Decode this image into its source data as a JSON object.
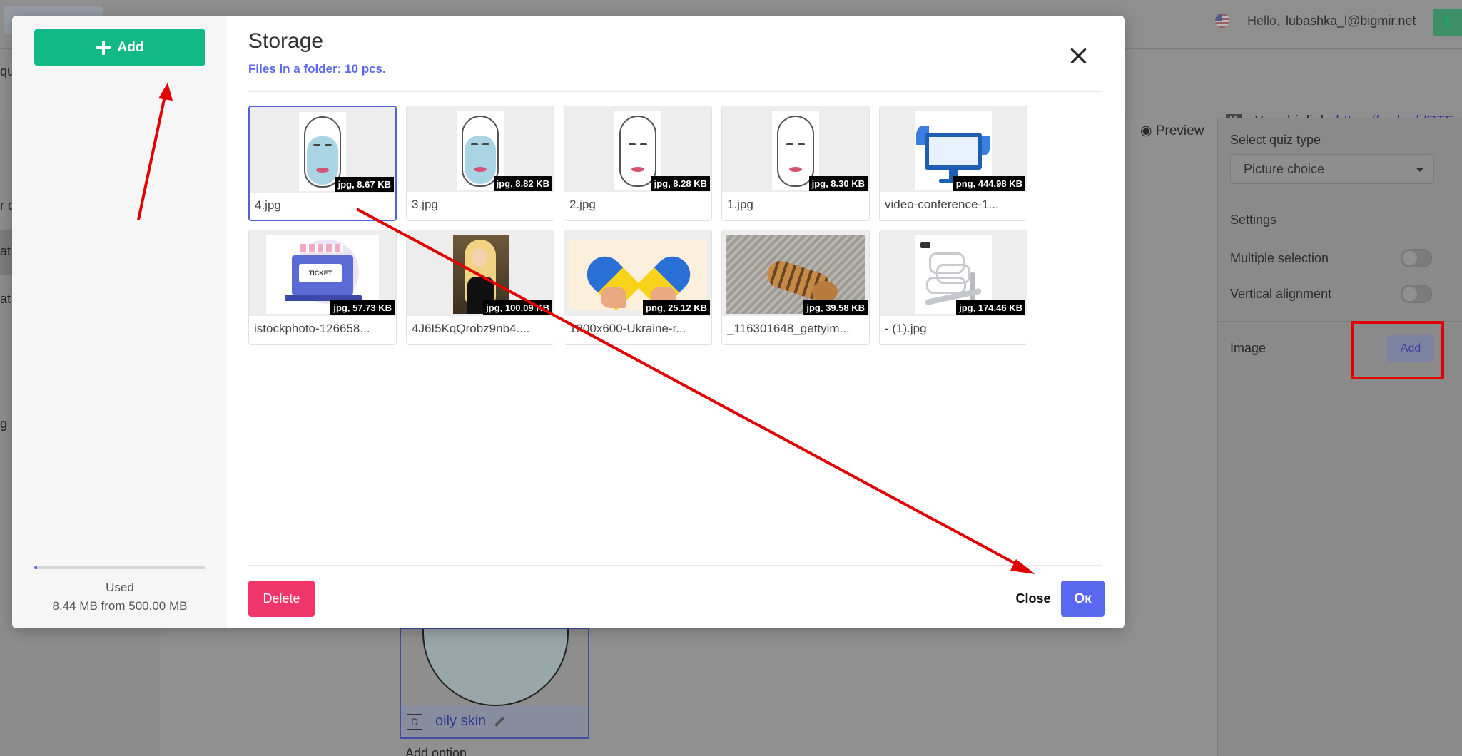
{
  "background": {
    "greeting_label": "Hello,",
    "user_email": "lubashka_l@bigmir.net",
    "biolink_label": "Your biolink:",
    "biolink_url": "https://webs.li/RTE",
    "left_fragments": [
      "qu",
      "r o",
      "at",
      "at",
      "g"
    ],
    "preview_label": "Preview",
    "settings_panel": {
      "quiz_type_label": "Select quiz type",
      "quiz_type_value": "Picture choice",
      "settings_heading": "Settings",
      "multiple_selection_label": "Multiple selection",
      "vertical_alignment_label": "Vertical alignment",
      "image_label": "Image",
      "image_add_button": "Add"
    },
    "option_card": {
      "letter": "D",
      "name": "oily skin"
    },
    "add_option_label": "Add option"
  },
  "modal": {
    "side": {
      "add_button_label": "Add",
      "usage_fraction": 0.0169,
      "used_label": "Used",
      "used_value": "8.44 MB from 500.00 MB"
    },
    "title": "Storage",
    "subtitle": "Files in a folder: 10 pcs.",
    "files": [
      {
        "name": "4.jpg",
        "badge": "jpg, 8.67 KB",
        "selected": true
      },
      {
        "name": "3.jpg",
        "badge": "jpg, 8.82 KB",
        "selected": false
      },
      {
        "name": "2.jpg",
        "badge": "jpg, 8.28 KB",
        "selected": false
      },
      {
        "name": "1.jpg",
        "badge": "jpg, 8.30 KB",
        "selected": false
      },
      {
        "name": "video-conference-1...",
        "badge": "png, 444.98 KB",
        "selected": false
      },
      {
        "name": "istockphoto-126658...",
        "badge": "jpg, 57.73 KB",
        "selected": false
      },
      {
        "name": "4J6I5KqQrobz9nb4....",
        "badge": "jpg, 100.09 KB",
        "selected": false
      },
      {
        "name": "1200x600-Ukraine-r...",
        "badge": "png, 25.12 KB",
        "selected": false
      },
      {
        "name": "_116301648_gettyim...",
        "badge": "jpg, 39.58 KB",
        "selected": false
      },
      {
        "name": "- (1).jpg",
        "badge": "jpg, 174.46 KB",
        "selected": false
      }
    ],
    "ticket_text": "TICKET",
    "delete_label": "Delete",
    "close_label": "Close",
    "ok_label": "Ок"
  },
  "colors": {
    "accent_green": "#12b886",
    "accent_blue": "#5a68f0",
    "danger_pink": "#f0356b",
    "annotation_red": "#e00000"
  }
}
